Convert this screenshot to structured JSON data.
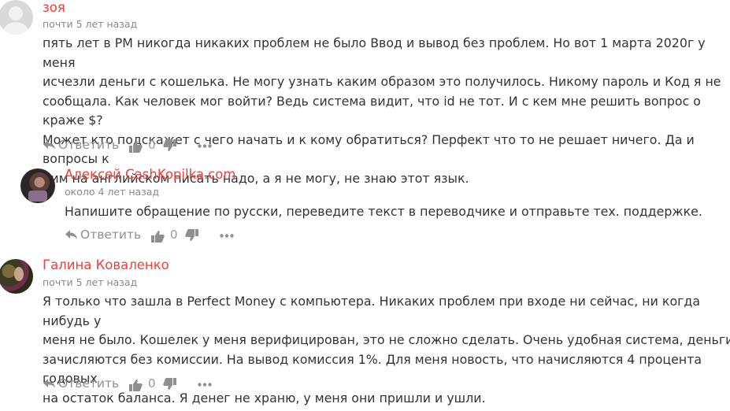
{
  "comments": [
    {
      "author": "зоя",
      "date": "почти 5 лет назад",
      "lines": [
        "пять лет в PM никогда никаких проблем не было Ввод и вывод без проблем. Но вот 1 марта 2020г у меня",
        "исчезли деньги с кошелька. Не могу узнать каким образом это получилось. Никому пароль и Код я не",
        "сообщала. Как человек мог войти? Ведь система видит, что id не тот. И с кем мне решить вопрос о краже $?",
        "Может кто подскажет с чего начать и к кому обратиться? Перфект что то не решает ничего. Да и вопросы к",
        "ним на английском писать надо, а я не могу, не знаю этот язык."
      ],
      "reply_label": "Ответить",
      "likes": "0"
    },
    {
      "author": "Алексей CashKopilka.com",
      "date": "около 4 лет назад",
      "lines": [
        "Напишите обращение по русски, переведите текст в переводчике и отправьте тех. поддержке."
      ],
      "reply_label": "Ответить",
      "likes": "0"
    },
    {
      "author": "Галина Коваленко",
      "date": "почти 5 лет назад",
      "lines": [
        "Я только что зашла в Perfect Money с компьютера. Никаких проблем при входе ни сейчас, ни когда нибудь у",
        "меня не было. Кошелек у меня верифицирован, это не сложно сделать. Очень удобная система, деньги",
        "зачисляются без комиссии. На вывод комиссия 1%. Для меня новость, что начисляются 4 процента годовых",
        "на остаток баланса. Я денег не храню, у меня они пришли и ушли."
      ],
      "reply_label": "Ответить",
      "likes": "0"
    }
  ],
  "colors": {
    "author": "#e8433e",
    "meta": "#8a8a8a",
    "text": "#333333",
    "icons": "#8f8f8f"
  },
  "icons": {
    "reply": "reply-icon",
    "like": "thumbs-up-icon",
    "dislike": "thumbs-down-icon",
    "more": "more-icon"
  }
}
